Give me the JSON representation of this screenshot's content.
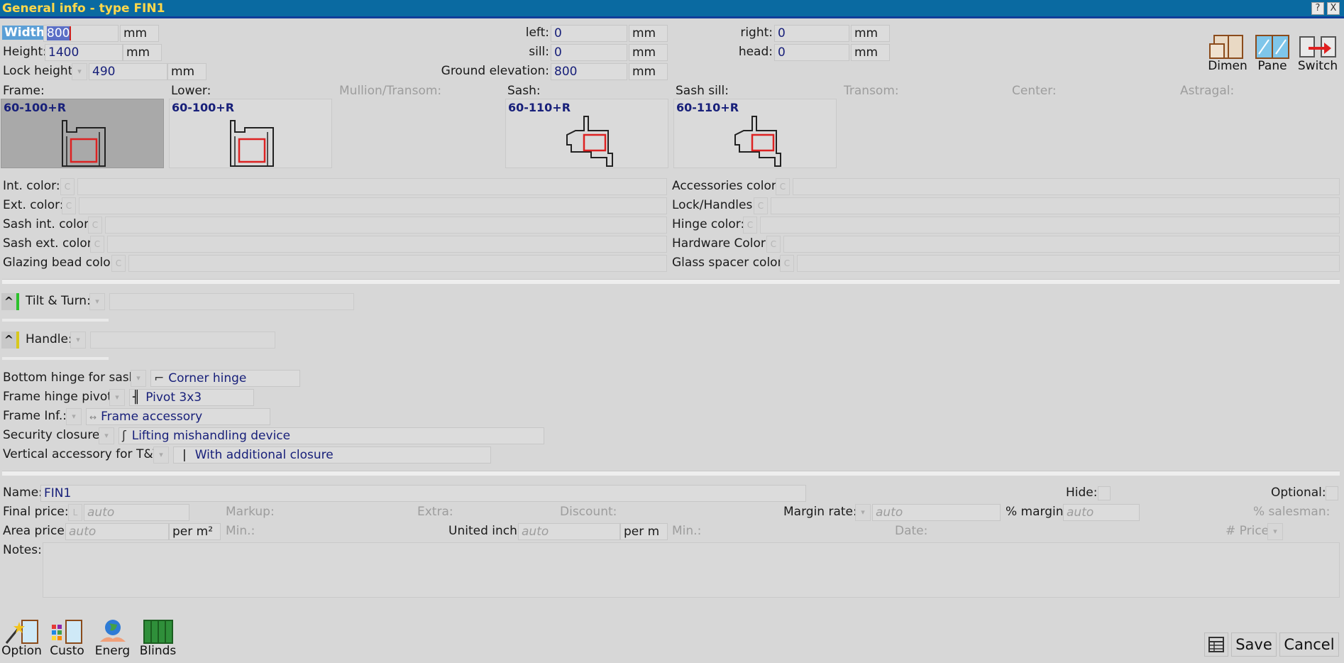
{
  "window": {
    "title": "General info - type FIN1",
    "help_label": "?",
    "close_label": "X"
  },
  "dimensions": {
    "width_label": "Width:",
    "width_value": "800",
    "height_label": "Height:",
    "height_value": "1400",
    "lock_height_label": "Lock height:",
    "lock_height_value": "490",
    "left_label": "left:",
    "left_value": "0",
    "sill_label": "sill:",
    "sill_value": "0",
    "ground_label": "Ground elevation:",
    "ground_value": "800",
    "right_label": "right:",
    "right_value": "0",
    "head_label": "head:",
    "head_value": "0",
    "unit": "mm"
  },
  "toolbar_top": {
    "dimen_label": "Dimen",
    "pane_label": "Pane",
    "switch_label": "Switch"
  },
  "profiles": {
    "frame_label": "Frame:",
    "frame_code": "60-100+R",
    "lower_label": "Lower:",
    "lower_code": "60-100+R",
    "mullion_label": "Mullion/Transom:",
    "sash_label": "Sash:",
    "sash_code": "60-110+R",
    "sash_sill_label": "Sash sill:",
    "sash_sill_code": "60-110+R",
    "transom_label": "Transom:",
    "center_label": "Center:",
    "astragal_label": "Astragal:"
  },
  "colors": {
    "c_label": "C",
    "int_label": "Int. color:",
    "ext_label": "Ext. color:",
    "sash_int_label": "Sash int. color:",
    "sash_ext_label": "Sash ext. color:",
    "glazing_bead_label": "Glazing bead color:",
    "accessories_label": "Accessories color:",
    "lock_handles_label": "Lock/Handles:",
    "hinge_label": "Hinge color:",
    "hardware_label": "Hardware Color:",
    "glass_spacer_label": "Glass spacer color:"
  },
  "hardware": {
    "tilt_turn_label": "Tilt & Turn:",
    "handle_label": "Handle:",
    "bottom_hinge_label": "Bottom hinge for sash:",
    "bottom_hinge_value": "Corner hinge",
    "frame_hinge_label": "Frame hinge pivot:",
    "frame_hinge_value": "Pivot 3x3",
    "frame_inf_label": "Frame Inf.:",
    "frame_inf_value": "Frame accessory",
    "security_label": "Security closure:",
    "security_value": "Lifting mishandling device",
    "vertical_label": "Vertical accessory for T&T:",
    "vertical_value": "With additional closure"
  },
  "pricing": {
    "name_label": "Name:",
    "name_value": "FIN1",
    "hide_label": "Hide:",
    "optional_label": "Optional:",
    "final_price_label": "Final price:",
    "final_price_lock": "L",
    "auto": "auto",
    "markup_label": "Markup:",
    "extra_label": "Extra:",
    "discount_label": "Discount:",
    "margin_rate_label": "Margin rate:",
    "pct_margin_label": "% margin:",
    "pct_salesman_label": "% salesman:",
    "area_price_label": "Area price:",
    "area_unit": "per m²",
    "min_label": "Min.:",
    "united_inch_label": "United inch:",
    "united_unit": "per m",
    "date_label": "Date:",
    "num_price_label": "# Price:",
    "notes_label": "Notes:"
  },
  "toolbar_bottom": {
    "option_label": "Option",
    "custo_label": "Custo",
    "energ_label": "Energ",
    "blinds_label": "Blinds"
  },
  "footer": {
    "save_label": "Save",
    "cancel_label": "Cancel"
  },
  "accents": {
    "title_bg": "#0a6aa1",
    "title_text": "#ffd84a",
    "value_text": "#18207a",
    "tilt_marker": "#2cc12c",
    "handle_marker": "#d8c81c"
  }
}
